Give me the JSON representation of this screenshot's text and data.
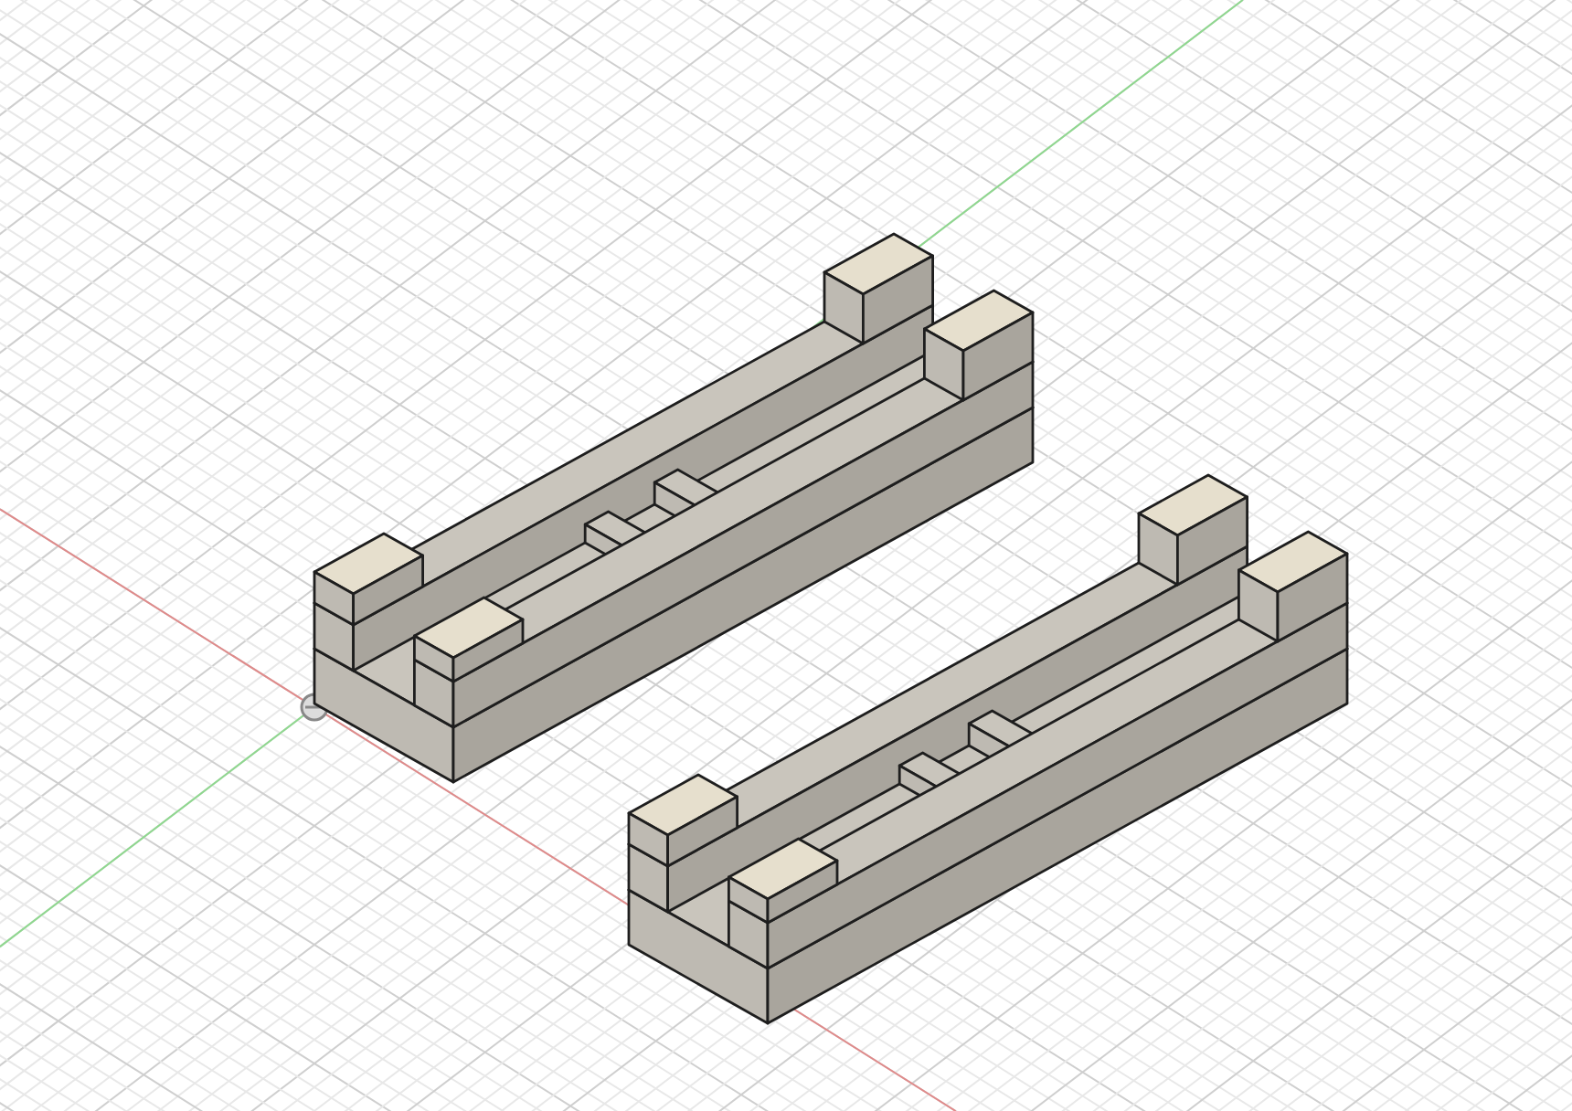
{
  "viewport": {
    "grid": true,
    "axes": true,
    "origin_marker": true,
    "parts": [
      {
        "kind": "channel-block"
      },
      {
        "kind": "channel-block"
      }
    ]
  }
}
